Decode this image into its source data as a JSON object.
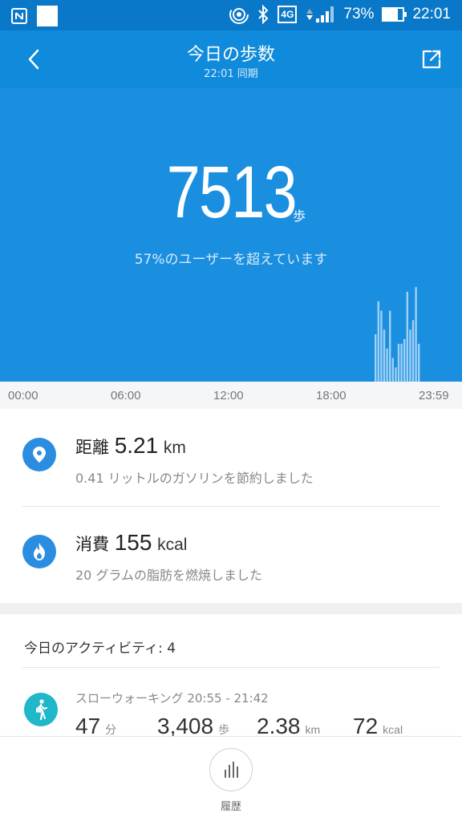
{
  "status_bar": {
    "network_type": "4G",
    "battery": "73%",
    "battery_level": 0.73,
    "time": "22:01"
  },
  "header": {
    "title": "今日の歩数",
    "sync_time": "22:01 同期",
    "back_icon": "chevron-left-icon",
    "share_icon": "share-icon"
  },
  "summary": {
    "steps": "7513",
    "unit": "歩",
    "percentile_text": "57%のユーザーを超えています"
  },
  "hourly_steps": [
    0,
    0,
    0,
    0,
    0,
    0,
    0,
    0,
    0,
    0,
    0,
    0,
    0,
    0,
    0,
    0,
    0,
    0,
    0,
    0,
    0,
    0,
    0,
    0,
    0,
    0,
    0,
    0,
    0,
    0,
    0,
    0,
    0,
    0,
    0,
    0,
    0,
    0,
    0,
    0,
    0,
    0,
    0,
    0,
    0,
    0,
    0,
    0,
    0,
    0,
    0,
    0,
    0,
    0,
    0,
    0,
    0,
    0,
    0,
    0,
    0,
    0,
    0,
    0,
    0,
    0,
    0,
    0,
    0,
    0,
    0,
    0,
    0,
    0,
    0,
    0,
    0,
    0,
    0,
    0,
    0,
    0,
    0,
    0,
    0,
    0,
    0,
    0,
    0,
    0,
    0,
    0,
    0,
    0,
    0,
    0,
    0,
    0,
    0,
    0,
    0,
    0,
    0,
    0,
    0,
    0,
    0,
    0,
    0,
    0,
    0,
    0,
    0,
    0,
    0,
    0,
    0,
    0,
    0,
    0,
    0,
    0,
    0,
    0,
    0,
    0,
    0,
    0,
    0,
    0,
    0,
    0,
    0,
    0,
    0,
    0,
    0,
    0,
    0,
    0,
    0,
    0,
    0,
    0,
    0,
    0,
    0,
    0,
    0,
    0,
    0,
    0,
    0,
    0,
    0,
    0,
    0,
    0,
    0,
    0,
    0,
    0,
    0,
    0,
    0,
    0,
    0,
    0,
    0,
    0,
    0,
    0,
    0,
    0,
    0,
    0,
    0,
    0,
    0,
    0,
    0,
    0,
    0,
    0,
    0,
    0,
    0,
    0,
    0,
    0,
    0,
    0,
    0,
    0,
    0,
    0,
    0,
    0,
    0,
    0,
    0,
    0,
    0,
    0,
    0,
    0,
    0,
    0,
    0,
    0,
    0,
    0,
    0,
    0,
    0,
    0,
    0,
    0,
    0,
    0,
    0,
    0,
    0,
    0,
    0,
    0,
    0,
    0,
    0,
    0,
    0,
    0,
    0,
    0,
    0,
    0,
    0,
    0,
    0,
    0,
    0,
    0,
    0,
    0,
    0,
    0,
    0,
    0,
    0,
    0,
    0,
    0,
    0,
    0,
    0,
    0,
    0,
    0,
    0,
    0,
    0,
    0,
    0,
    0,
    0,
    0,
    0,
    0,
    0,
    0,
    0,
    0,
    0,
    0,
    0,
    0,
    0,
    0,
    0,
    0,
    0,
    0,
    0,
    0,
    0,
    0,
    0,
    0,
    0,
    0
  ],
  "activity_bars": [
    0.5,
    0.85,
    0.75,
    0.55,
    0.35,
    0.75,
    0.25,
    0.15,
    0.4,
    0.4,
    0.45,
    0.95,
    0.55,
    0.65,
    1.0,
    0.4
  ],
  "timeline": {
    "labels": [
      "00:00",
      "06:00",
      "12:00",
      "18:00",
      "23:59"
    ]
  },
  "distance": {
    "label": "距離",
    "value": "5.21",
    "unit": "km",
    "sub": "0.41 リットルのガソリンを節約しました",
    "icon": "location-pin-icon"
  },
  "calories": {
    "label": "消費",
    "value": "155",
    "unit": "kcal",
    "sub": "20 グラムの脂肪を燃焼しました",
    "icon": "flame-icon"
  },
  "activities": {
    "title": "今日のアクティビティ: 4",
    "first": {
      "name": "スローウォーキング 20:55 - 21:42",
      "icon": "walking-person-icon",
      "duration": "47",
      "duration_unit": "分",
      "steps": "3,408",
      "steps_unit": "歩",
      "distance": "2.38",
      "distance_unit": "km",
      "calories": "72",
      "calories_unit": "kcal"
    }
  },
  "bottom_nav": {
    "history_label": "履歴",
    "history_icon": "bar-chart-icon"
  },
  "colors": {
    "header": "#108ada",
    "hero": "#1a8fe0",
    "status_bar": "#0a78c8",
    "distance_icon": "#2b8de0",
    "activity_icon": "#1fb7c9"
  }
}
